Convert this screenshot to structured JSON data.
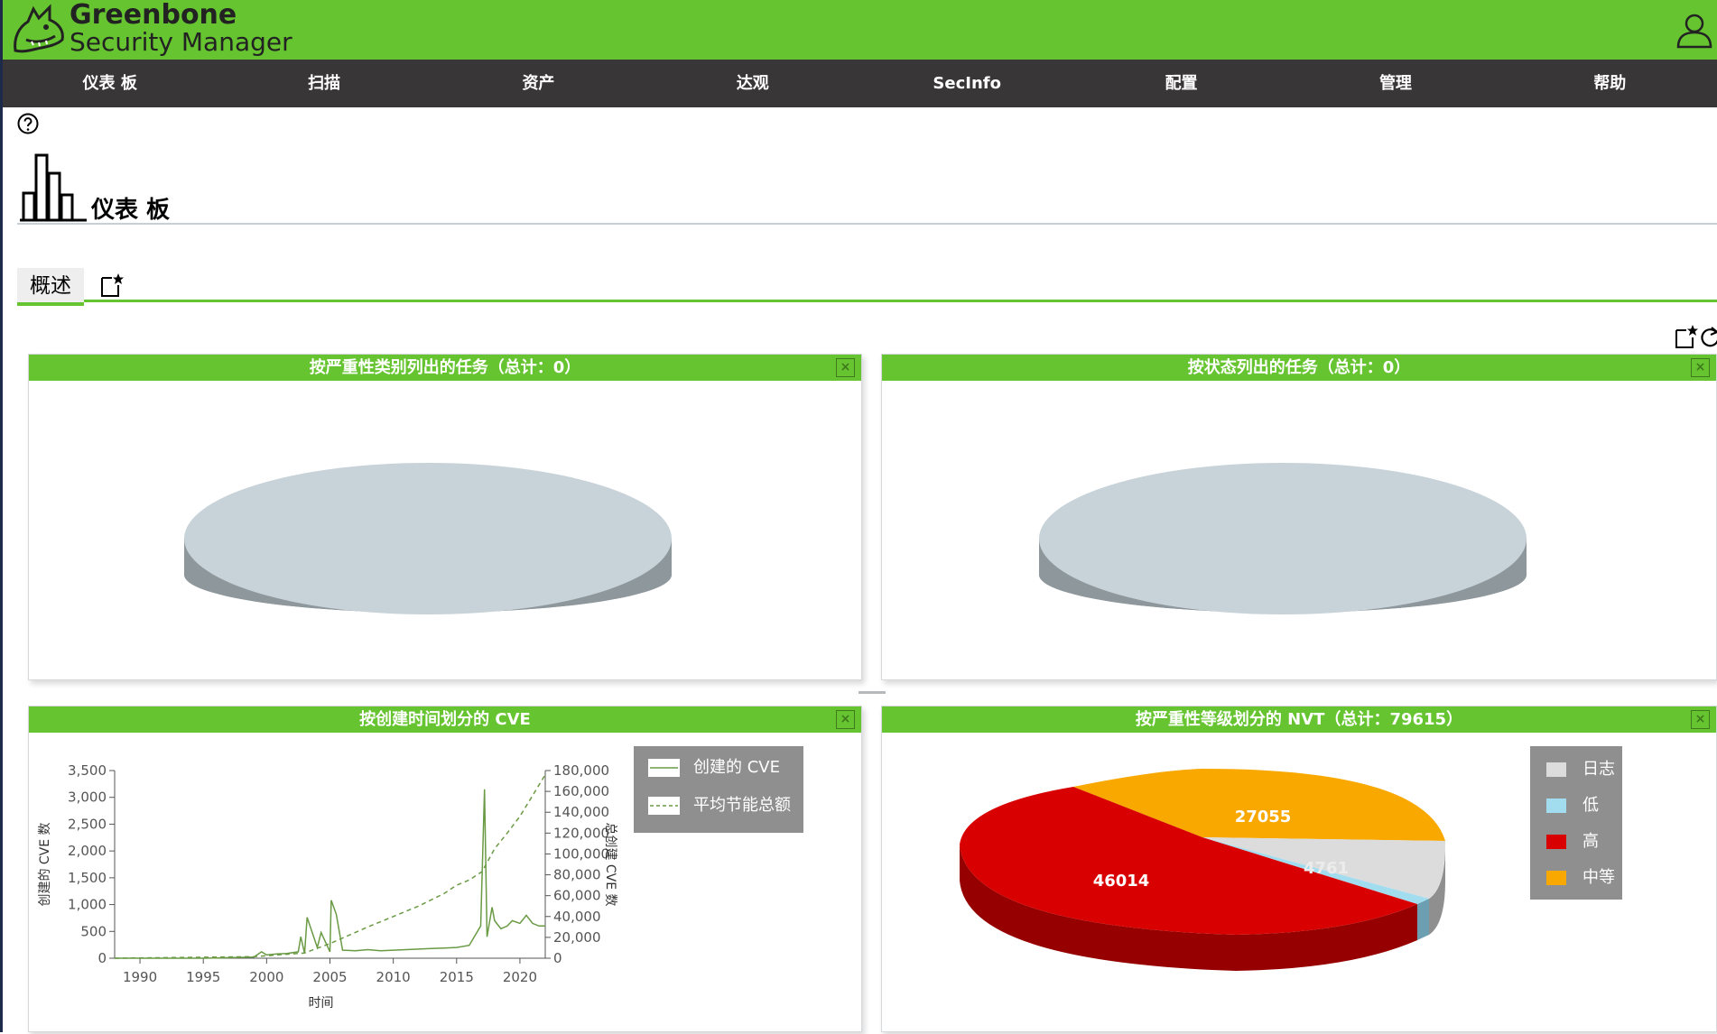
{
  "app": {
    "name_line1": "Greenbone",
    "name_line2": "Security Manager"
  },
  "menu": [
    "仪表 板",
    "扫描",
    "资产",
    "达观",
    "SecInfo",
    "配置",
    "管理",
    "帮助"
  ],
  "page": {
    "title": "仪表 板",
    "tab": "概述"
  },
  "panels": {
    "tasks_by_severity": {
      "title": "按严重性类别列出的任务（总计：0）"
    },
    "tasks_by_status": {
      "title": "按状态列出的任务（总计：0）"
    },
    "cve_by_time": {
      "title": "按创建时间划分的 CVE",
      "legend": [
        "创建的 CVE",
        "平均节能总额"
      ]
    },
    "nvt_by_severity": {
      "title": "按严重性等级划分的 NVT（总计：79615）",
      "legend": [
        "日志",
        "低",
        "高",
        "中等"
      ]
    }
  },
  "close_glyph": "×",
  "colors": {
    "brand": "#66c430",
    "menubar": "#393637",
    "high": "#d80000",
    "medium": "#f9a800",
    "low": "#a1ddef",
    "log": "#dcdcdc",
    "empty_pie": "#c7d2d9"
  },
  "chart_data": [
    {
      "type": "pie",
      "title": "按严重性类别列出的任务（总计：0）",
      "slices": []
    },
    {
      "type": "pie",
      "title": "按状态列出的任务（总计：0）",
      "slices": []
    },
    {
      "type": "line",
      "title": "按创建时间划分的 CVE",
      "xlabel": "时间",
      "ylabel": "创建的 CVE 数",
      "y2label": "总创建 CVE 数",
      "xlim": [
        1988,
        2022
      ],
      "ylim": [
        0,
        3500
      ],
      "y2lim": [
        0,
        180000
      ],
      "xticks": [
        "1990",
        "1995",
        "2000",
        "2005",
        "2010",
        "2015",
        "2020"
      ],
      "yticks": [
        "0",
        "500",
        "1,000",
        "1,500",
        "2,000",
        "2,500",
        "3,000",
        "3,500"
      ],
      "y2ticks": [
        "0",
        "20,000",
        "40,000",
        "60,000",
        "80,000",
        "100,000",
        "120,000",
        "140,000",
        "160,000",
        "180,000"
      ],
      "series": [
        {
          "name": "创建的 CVE",
          "style": "solid",
          "x": [
            1988,
            1995,
            1999,
            1999.6,
            2000,
            2000.8,
            2001.6,
            2002.5,
            2002.7,
            2003,
            2003.2,
            2004,
            2004.3,
            2005,
            2005.1,
            2005.5,
            2006,
            2007,
            2008,
            2009,
            2010,
            2011,
            2012,
            2013,
            2014,
            2015,
            2016,
            2016.9,
            2017.2,
            2017.4,
            2017.8,
            2018,
            2018.5,
            2019,
            2019.4,
            2020,
            2020.5,
            2021,
            2021.5,
            2022
          ],
          "y": [
            0,
            0,
            20,
            120,
            60,
            80,
            90,
            120,
            400,
            90,
            760,
            200,
            480,
            120,
            1080,
            820,
            150,
            140,
            160,
            140,
            150,
            160,
            170,
            180,
            190,
            200,
            240,
            600,
            3150,
            400,
            950,
            700,
            550,
            600,
            700,
            650,
            800,
            650,
            600,
            600
          ]
        },
        {
          "name": "平均节能总额",
          "style": "dashed",
          "x": [
            1988,
            1999,
            2003,
            2005,
            2008,
            2010,
            2012,
            2014,
            2015,
            2016,
            2017,
            2018,
            2019,
            2020,
            2021,
            2022
          ],
          "y": [
            0,
            1500,
            5000,
            14000,
            30000,
            40000,
            50000,
            62000,
            70000,
            75000,
            83000,
            105000,
            120000,
            136000,
            156000,
            176000
          ]
        }
      ]
    },
    {
      "type": "pie",
      "title": "按严重性等级划分的 NVT（总计：79615）",
      "slices": [
        {
          "label": "日志",
          "value": 1785,
          "color": "#dcdcdc"
        },
        {
          "label": "低",
          "value": 761,
          "color": "#a1ddef"
        },
        {
          "label": "高",
          "value": 46014,
          "color": "#d80000"
        },
        {
          "label": "中等",
          "value": 27055,
          "color": "#f9a800"
        }
      ],
      "labels_shown": [
        "27055",
        "46014",
        "4761"
      ]
    }
  ]
}
